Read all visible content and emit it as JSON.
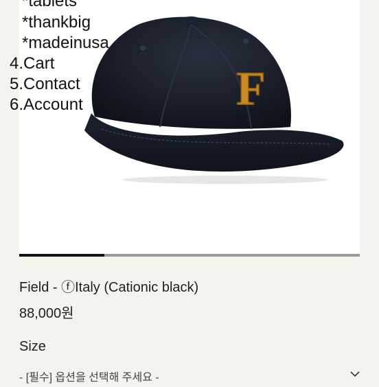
{
  "menu": {
    "items": [
      {
        "label": "*tablets"
      },
      {
        "label": "*thankbig"
      },
      {
        "label": "*madeinusa"
      },
      {
        "label": "4.Cart"
      },
      {
        "label": "5.Contact"
      },
      {
        "label": "6.Account"
      }
    ]
  },
  "product": {
    "logo_letter": "F",
    "title": "Field - ⓕItaly (Cationic black)",
    "price": "88,000원"
  },
  "gallery": {
    "progress": 0.25
  },
  "option": {
    "label": "Size",
    "select_placeholder": "- [필수] 옵션을 선택해 주세요 -"
  },
  "colors": {
    "background": "#f5f3ee",
    "cap": "#161a26",
    "logo_gold": "#c98a1f"
  }
}
